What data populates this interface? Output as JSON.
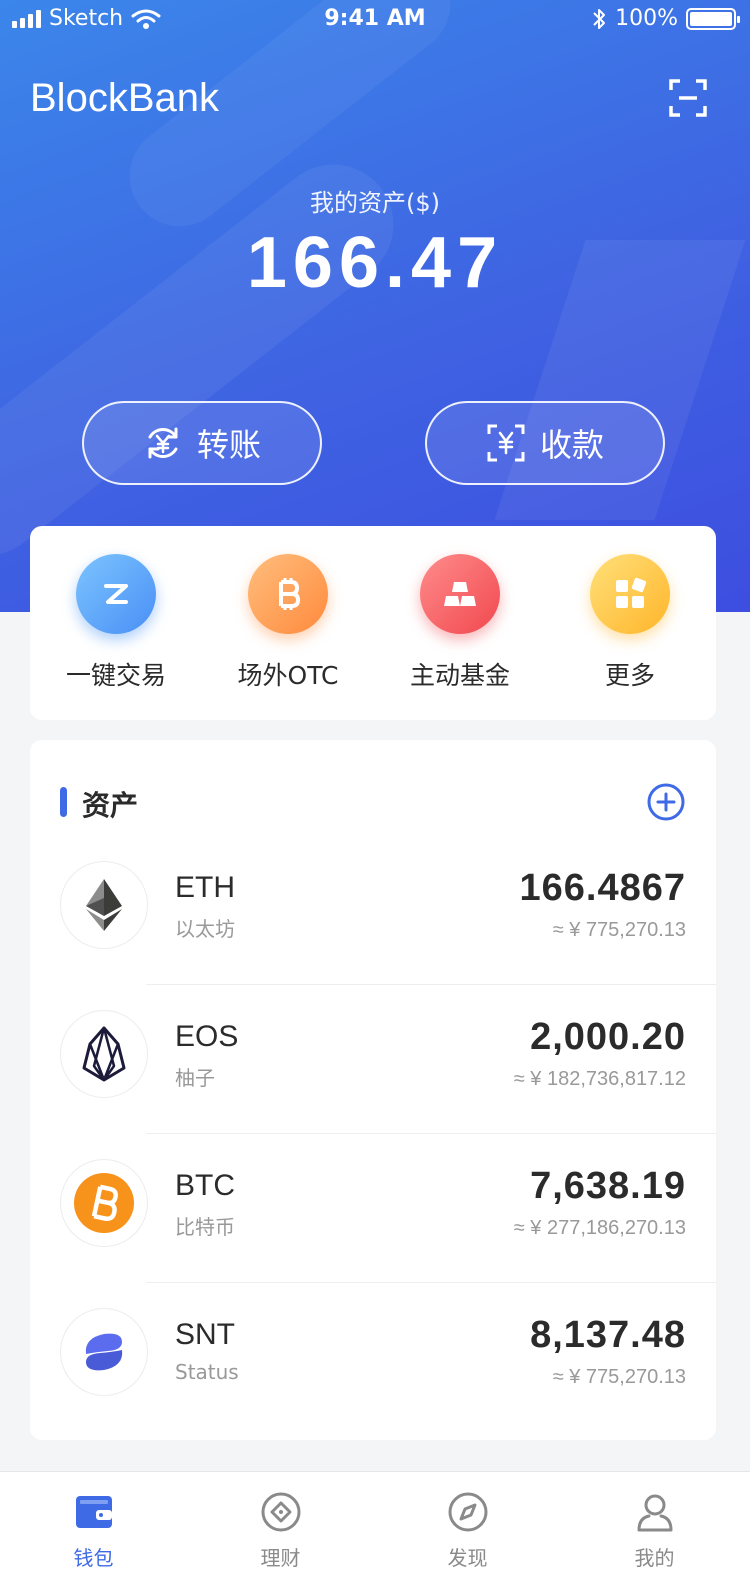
{
  "status_bar": {
    "carrier": "Sketch",
    "time": "9:41 AM",
    "battery": "100%"
  },
  "header": {
    "app_title": "BlockBank",
    "scan_icon": "scan-icon"
  },
  "summary": {
    "label": "我的资产($)",
    "value": "166.47"
  },
  "actions": {
    "transfer_label": "转账",
    "receive_label": "收款"
  },
  "quick_actions": [
    {
      "label": "一键交易",
      "icon": "swap-icon",
      "color": "#4a8ff5"
    },
    {
      "label": "场外OTC",
      "icon": "bitcoin-icon",
      "color": "#ff8a3d"
    },
    {
      "label": "主动基金",
      "icon": "gold-bars-icon",
      "color": "#f0484e"
    },
    {
      "label": "更多",
      "icon": "apps-icon",
      "color": "#ffb52a"
    }
  ],
  "assets_section": {
    "title": "资产",
    "add_icon": "add-circle-icon"
  },
  "assets": [
    {
      "symbol": "ETH",
      "name": "以太坊",
      "amount": "166.4867",
      "fiat": "≈ ¥ 775,270.13"
    },
    {
      "symbol": "EOS",
      "name": "柚子",
      "amount": "2,000.20",
      "fiat": "≈ ¥ 182,736,817.12"
    },
    {
      "symbol": "BTC",
      "name": "比特币",
      "amount": "7,638.19",
      "fiat": "≈ ¥ 277,186,270.13"
    },
    {
      "symbol": "SNT",
      "name": "Status",
      "amount": "8,137.48",
      "fiat": "≈ ¥ 775,270.13"
    }
  ],
  "tabs": [
    {
      "label": "钱包",
      "icon": "wallet-icon",
      "active": true
    },
    {
      "label": "理财",
      "icon": "finance-icon",
      "active": false
    },
    {
      "label": "发现",
      "icon": "compass-icon",
      "active": false
    },
    {
      "label": "我的",
      "icon": "profile-icon",
      "active": false
    }
  ],
  "colors": {
    "brand_blue": "#3f6ae6",
    "hero_gradient_start": "#3b86ea",
    "hero_gradient_end": "#3d4ee0"
  }
}
